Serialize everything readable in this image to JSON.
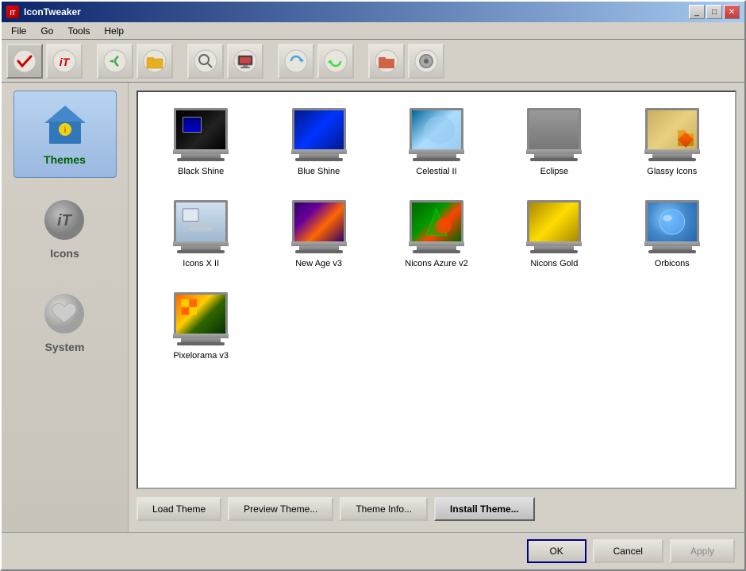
{
  "window": {
    "title": "IconTweaker",
    "title_icon": "IT"
  },
  "menu": {
    "items": [
      "File",
      "Go",
      "Tools",
      "Help"
    ]
  },
  "toolbar": {
    "buttons": [
      {
        "name": "check",
        "icon": "✔",
        "active": true
      },
      {
        "name": "itweak",
        "icon": "iT",
        "active": false
      },
      {
        "name": "sep1",
        "separator": true
      },
      {
        "name": "arrow-back",
        "icon": "↩",
        "active": false
      },
      {
        "name": "folder-open",
        "icon": "📁",
        "active": false
      },
      {
        "name": "sep2",
        "separator": true
      },
      {
        "name": "search",
        "icon": "🔍",
        "active": false
      },
      {
        "name": "screen",
        "icon": "🖥",
        "active": false
      },
      {
        "name": "sep3",
        "separator": true
      },
      {
        "name": "refresh-blue",
        "icon": "↻",
        "active": false
      },
      {
        "name": "refresh-green",
        "icon": "♻",
        "active": false
      },
      {
        "name": "sep4",
        "separator": true
      },
      {
        "name": "folder-red",
        "icon": "📂",
        "active": false
      },
      {
        "name": "disk",
        "icon": "💿",
        "active": false
      }
    ]
  },
  "sidebar": {
    "items": [
      {
        "name": "themes",
        "label": "Themes",
        "active": true
      },
      {
        "name": "icons",
        "label": "Icons",
        "active": false
      },
      {
        "name": "system",
        "label": "System",
        "active": false
      }
    ]
  },
  "themes": {
    "grid": [
      {
        "name": "Black Shine",
        "screen_class": "screen-black-shine"
      },
      {
        "name": "Blue Shine",
        "screen_class": "screen-blue-shine"
      },
      {
        "name": "Celestial II",
        "screen_class": "screen-celestial"
      },
      {
        "name": "Eclipse",
        "screen_class": "screen-eclipse"
      },
      {
        "name": "Glassy Icons",
        "screen_class": "screen-glassy",
        "has_folder": true
      },
      {
        "name": "Icons X II",
        "screen_class": "screen-iconsxii"
      },
      {
        "name": "New Age v3",
        "screen_class": "screen-newage"
      },
      {
        "name": "Nicons Azure v2",
        "screen_class": "screen-niconsazure"
      },
      {
        "name": "Nicons Gold",
        "screen_class": "screen-niconsgold"
      },
      {
        "name": "Orbicons",
        "screen_class": "screen-orbicons"
      },
      {
        "name": "Pixelorama v3",
        "screen_class": "screen-pixelorama"
      }
    ]
  },
  "buttons": {
    "load_theme": "Load Theme",
    "preview_theme": "Preview Theme...",
    "theme_info": "Theme Info...",
    "install_theme": "Install Theme..."
  },
  "footer": {
    "ok": "OK",
    "cancel": "Cancel",
    "apply": "Apply"
  }
}
